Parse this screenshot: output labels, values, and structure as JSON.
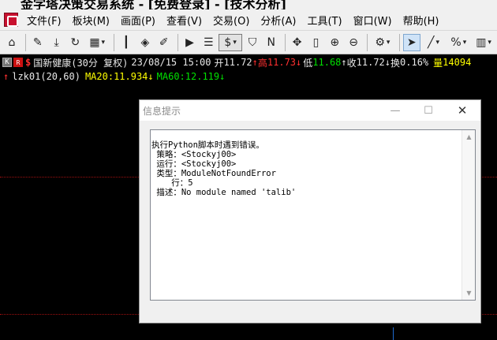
{
  "window": {
    "title": "金字塔决策交易系统 - [免费登录] - [技术分析]"
  },
  "menu": [
    {
      "id": "file",
      "label": "文件(F)"
    },
    {
      "id": "sector",
      "label": "板块(M)"
    },
    {
      "id": "screen",
      "label": "画面(P)"
    },
    {
      "id": "view",
      "label": "查看(V)"
    },
    {
      "id": "trade",
      "label": "交易(O)"
    },
    {
      "id": "analysis",
      "label": "分析(A)"
    },
    {
      "id": "tools",
      "label": "工具(T)"
    },
    {
      "id": "window",
      "label": "窗口(W)"
    },
    {
      "id": "help",
      "label": "帮助(H)"
    }
  ],
  "toolbar": {
    "icons": [
      {
        "name": "home-icon",
        "glyph": "⌂"
      },
      {
        "name": "pen-icon",
        "glyph": "✎"
      },
      {
        "name": "download-icon",
        "glyph": "⤓"
      },
      {
        "name": "refresh-icon",
        "glyph": "↻"
      },
      {
        "name": "grid-layout-icon",
        "glyph": "▦",
        "dropdown": true
      },
      {
        "name": "candlestick-icon",
        "glyph": "┃"
      },
      {
        "name": "diamond-icon",
        "glyph": "◈"
      },
      {
        "name": "edit-icon",
        "glyph": "✐"
      },
      {
        "name": "play-icon",
        "glyph": "▶"
      },
      {
        "name": "list-icon",
        "glyph": "☰"
      },
      {
        "name": "dollar-icon",
        "glyph": "$",
        "dropdown": true,
        "active": true
      },
      {
        "name": "filter-icon",
        "glyph": "⛉"
      },
      {
        "name": "table-n-icon",
        "glyph": "N"
      },
      {
        "name": "move-icon",
        "glyph": "✥"
      },
      {
        "name": "bar-icon",
        "glyph": "▯"
      },
      {
        "name": "zoom-in-icon",
        "glyph": "⊕"
      },
      {
        "name": "zoom-out-icon",
        "glyph": "⊖"
      },
      {
        "name": "gear-icon",
        "glyph": "⚙",
        "dropdown": true
      },
      {
        "name": "cursor-icon",
        "glyph": "➤",
        "pressed": true
      },
      {
        "name": "line-draw-icon",
        "glyph": "╱",
        "dropdown": true
      },
      {
        "name": "percent-icon",
        "glyph": "%",
        "dropdown": true
      },
      {
        "name": "panel-icon",
        "glyph": "▥",
        "dropdown": true
      }
    ]
  },
  "quote": {
    "k_badge": "K",
    "r_badge": "R",
    "dollar": "$",
    "name": "国新健康(30分 复权)",
    "datetime": "23/08/15 15:00",
    "open_label": "开",
    "open": "11.72",
    "high_label": "高",
    "high": "11.73",
    "low_label": "低",
    "low": "11.68",
    "close_label": "收",
    "close": "11.72",
    "turnover_label": "换",
    "turnover": "0.16%",
    "volume_label": "量",
    "volume": "14094",
    "arrow_up": "↑",
    "arrow_down": "↓"
  },
  "indicator": {
    "name": "lzk01(20,60)",
    "ma20_label": "MA20:",
    "ma20": "11.934",
    "ma60_label": "MA60:",
    "ma60": "12.119",
    "arrow_up": "↑",
    "arrow_down": "↓"
  },
  "colors": {
    "up": "#ff3030",
    "down": "#00e000",
    "ma20": "#ffff00",
    "ma60": "#00e000"
  },
  "dialog": {
    "title": "信息提示",
    "minimize": "—",
    "maximize": "☐",
    "close": "✕",
    "message": "执行Python脚本时遇到错误。\n 策略：<Stockyj00>\n 运行：<Stockyj00>\n 类型：ModuleNotFoundError\n    行：5\n 描述：No module named 'talib'",
    "scroll_up": "▲",
    "scroll_down": "▼"
  }
}
